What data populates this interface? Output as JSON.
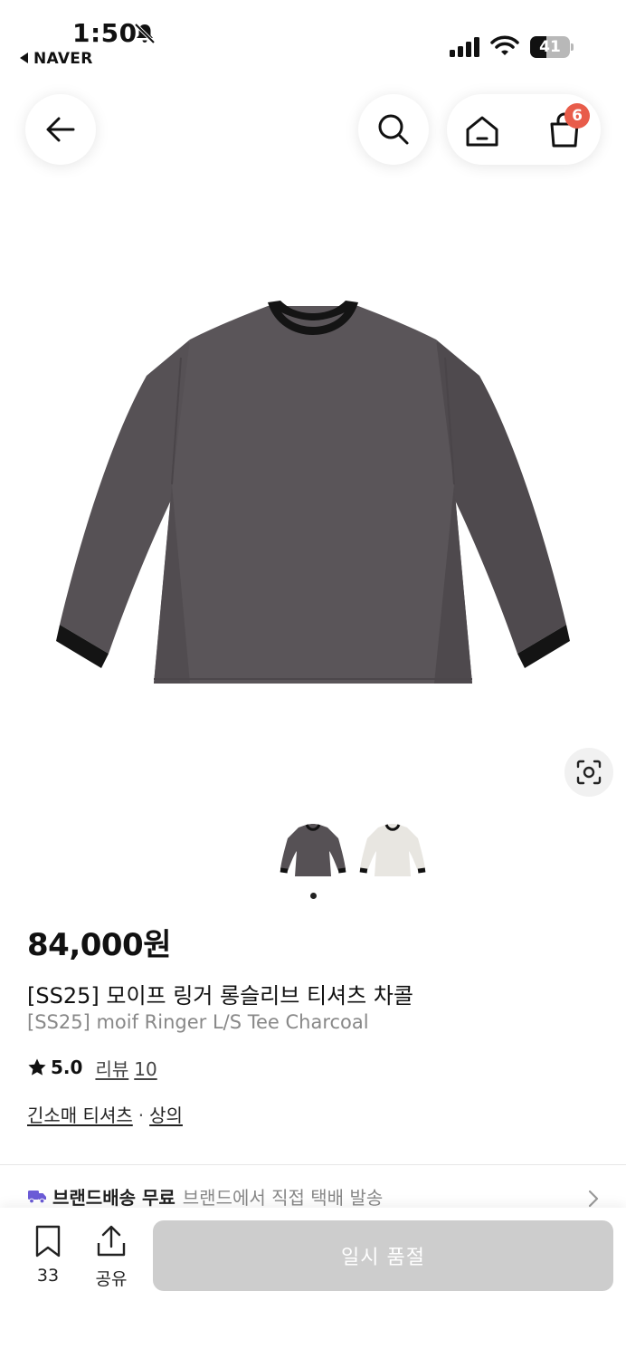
{
  "status_bar": {
    "time": "1:50",
    "back_app": "NAVER",
    "battery_level": "41",
    "battery_fraction": 0.41
  },
  "nav": {
    "cart_count": "6",
    "icons": [
      "back-arrow-icon",
      "search-icon",
      "home-icon",
      "shopping-bag-icon"
    ]
  },
  "product": {
    "price": "84,000원",
    "title_ko": "[SS25] 모이프 링거 롱슬리브 티셔츠 차콜",
    "title_en": "[SS25] moif Ringer L/S Tee Charcoal",
    "rating": "5.0",
    "review_label": "리뷰",
    "review_count": "10",
    "category_1": "긴소매 티셔츠",
    "category_sep": "·",
    "category_2": "상의",
    "colors": {
      "body": "#565155",
      "trim": "#111111",
      "alt_body": "#e8e6e1"
    }
  },
  "shipping": {
    "lead": "브랜드배송 무료",
    "desc": "브랜드에서 직접 택배 발송",
    "truck_color": "#6b5bd6"
  },
  "bottom_bar": {
    "bookmark_count": "33",
    "share_label": "공유",
    "soldout_label": "일시 품절"
  },
  "accent": {
    "badge": "#e85c4a"
  }
}
